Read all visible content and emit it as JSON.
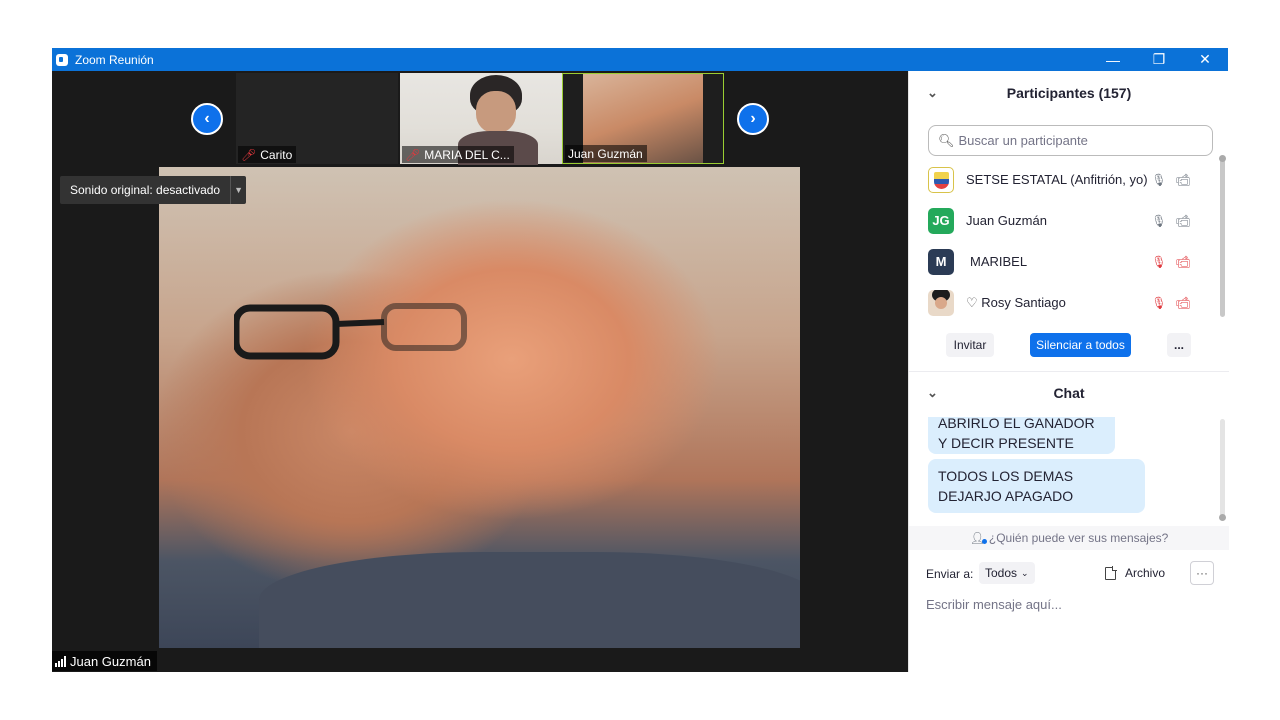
{
  "window": {
    "title": "Zoom Reunión",
    "controls": {
      "minimize": "—",
      "restore": "❐",
      "close": "✕"
    }
  },
  "video": {
    "thumbnails": [
      {
        "name": "Carito",
        "muted": true
      },
      {
        "name": "MARIA DEL C...",
        "muted": true
      },
      {
        "name": "Juan Guzmán",
        "muted": false
      }
    ],
    "nav": {
      "prev": "‹",
      "next": "›"
    },
    "sound_original": "Sonido original: desactivado",
    "speaker_name": "Juan Guzmán"
  },
  "participants": {
    "title": "Participantes (157)",
    "search_placeholder": "Buscar un participante",
    "list": [
      {
        "name": "SETSE ESTATAL (Anfitrión, yo)",
        "avatar": "",
        "mic": "on",
        "cam": "on"
      },
      {
        "name": "Juan Guzmán",
        "avatar": "JG",
        "mic": "on",
        "cam": "on"
      },
      {
        "name": "MARIBEL",
        "avatar": "M",
        "mic": "off",
        "cam": "off"
      },
      {
        "name": "Rosy Santiago",
        "avatar": "",
        "mic": "off",
        "cam": "off"
      }
    ],
    "buttons": {
      "invite": "Invitar",
      "mute_all": "Silenciar a todos",
      "more": "..."
    }
  },
  "chat": {
    "title": "Chat",
    "messages": [
      "ABRIRLO EL GANADOR Y DECIR PRESENTE",
      "TODOS LOS DEMAS DEJARJO APAGADO"
    ],
    "who_sees": "¿Quién puede ver sus mensajes?",
    "send_to_label": "Enviar a:",
    "send_to_value": "Todos",
    "file_label": "Archivo",
    "more": "···",
    "input_placeholder": "Escribir mensaje aquí..."
  },
  "colors": {
    "titlebar": "#0b72d8",
    "accent": "#0e71eb",
    "muted": "#e0393e",
    "bubble": "#dbeefd"
  }
}
